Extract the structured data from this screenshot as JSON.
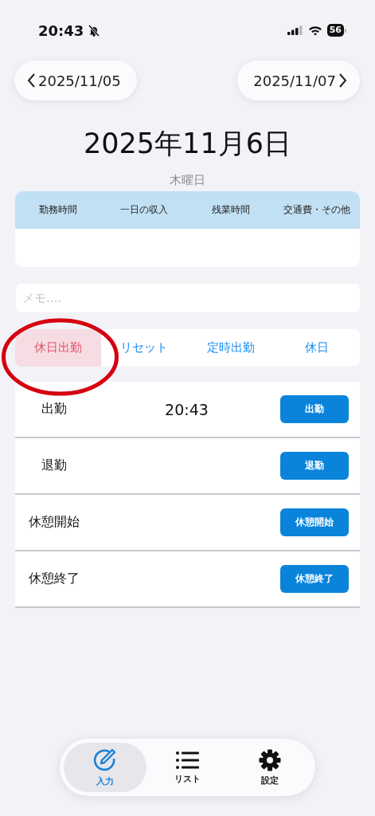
{
  "status_bar": {
    "time": "20:43",
    "battery": "56"
  },
  "date_nav": {
    "previous": "2025/11/05",
    "next": "2025/11/07"
  },
  "title": "2025年11月6日",
  "weekday": "木曜日",
  "summary": {
    "columns": [
      "勤務時間",
      "一日の収入",
      "残業時間",
      "交通費・その他"
    ]
  },
  "memo": {
    "placeholder": "メモ...."
  },
  "modes": [
    {
      "label": "休日出勤",
      "selected": true
    },
    {
      "label": "リセット",
      "selected": false
    },
    {
      "label": "定時出勤",
      "selected": false
    },
    {
      "label": "休日",
      "selected": false
    }
  ],
  "punches": [
    {
      "label": "出勤",
      "time": "20:43",
      "button": "出勤"
    },
    {
      "label": "退勤",
      "button": "退勤"
    },
    {
      "label": "休憩開始",
      "button": "休憩開始"
    },
    {
      "label": "休憩終了",
      "button": "休憩終了"
    }
  ],
  "tabs": [
    {
      "label": "入力",
      "kind": "edit",
      "selected": true
    },
    {
      "label": "リスト",
      "kind": "list",
      "selected": false
    },
    {
      "label": "設定",
      "kind": "gear",
      "selected": false
    }
  ]
}
